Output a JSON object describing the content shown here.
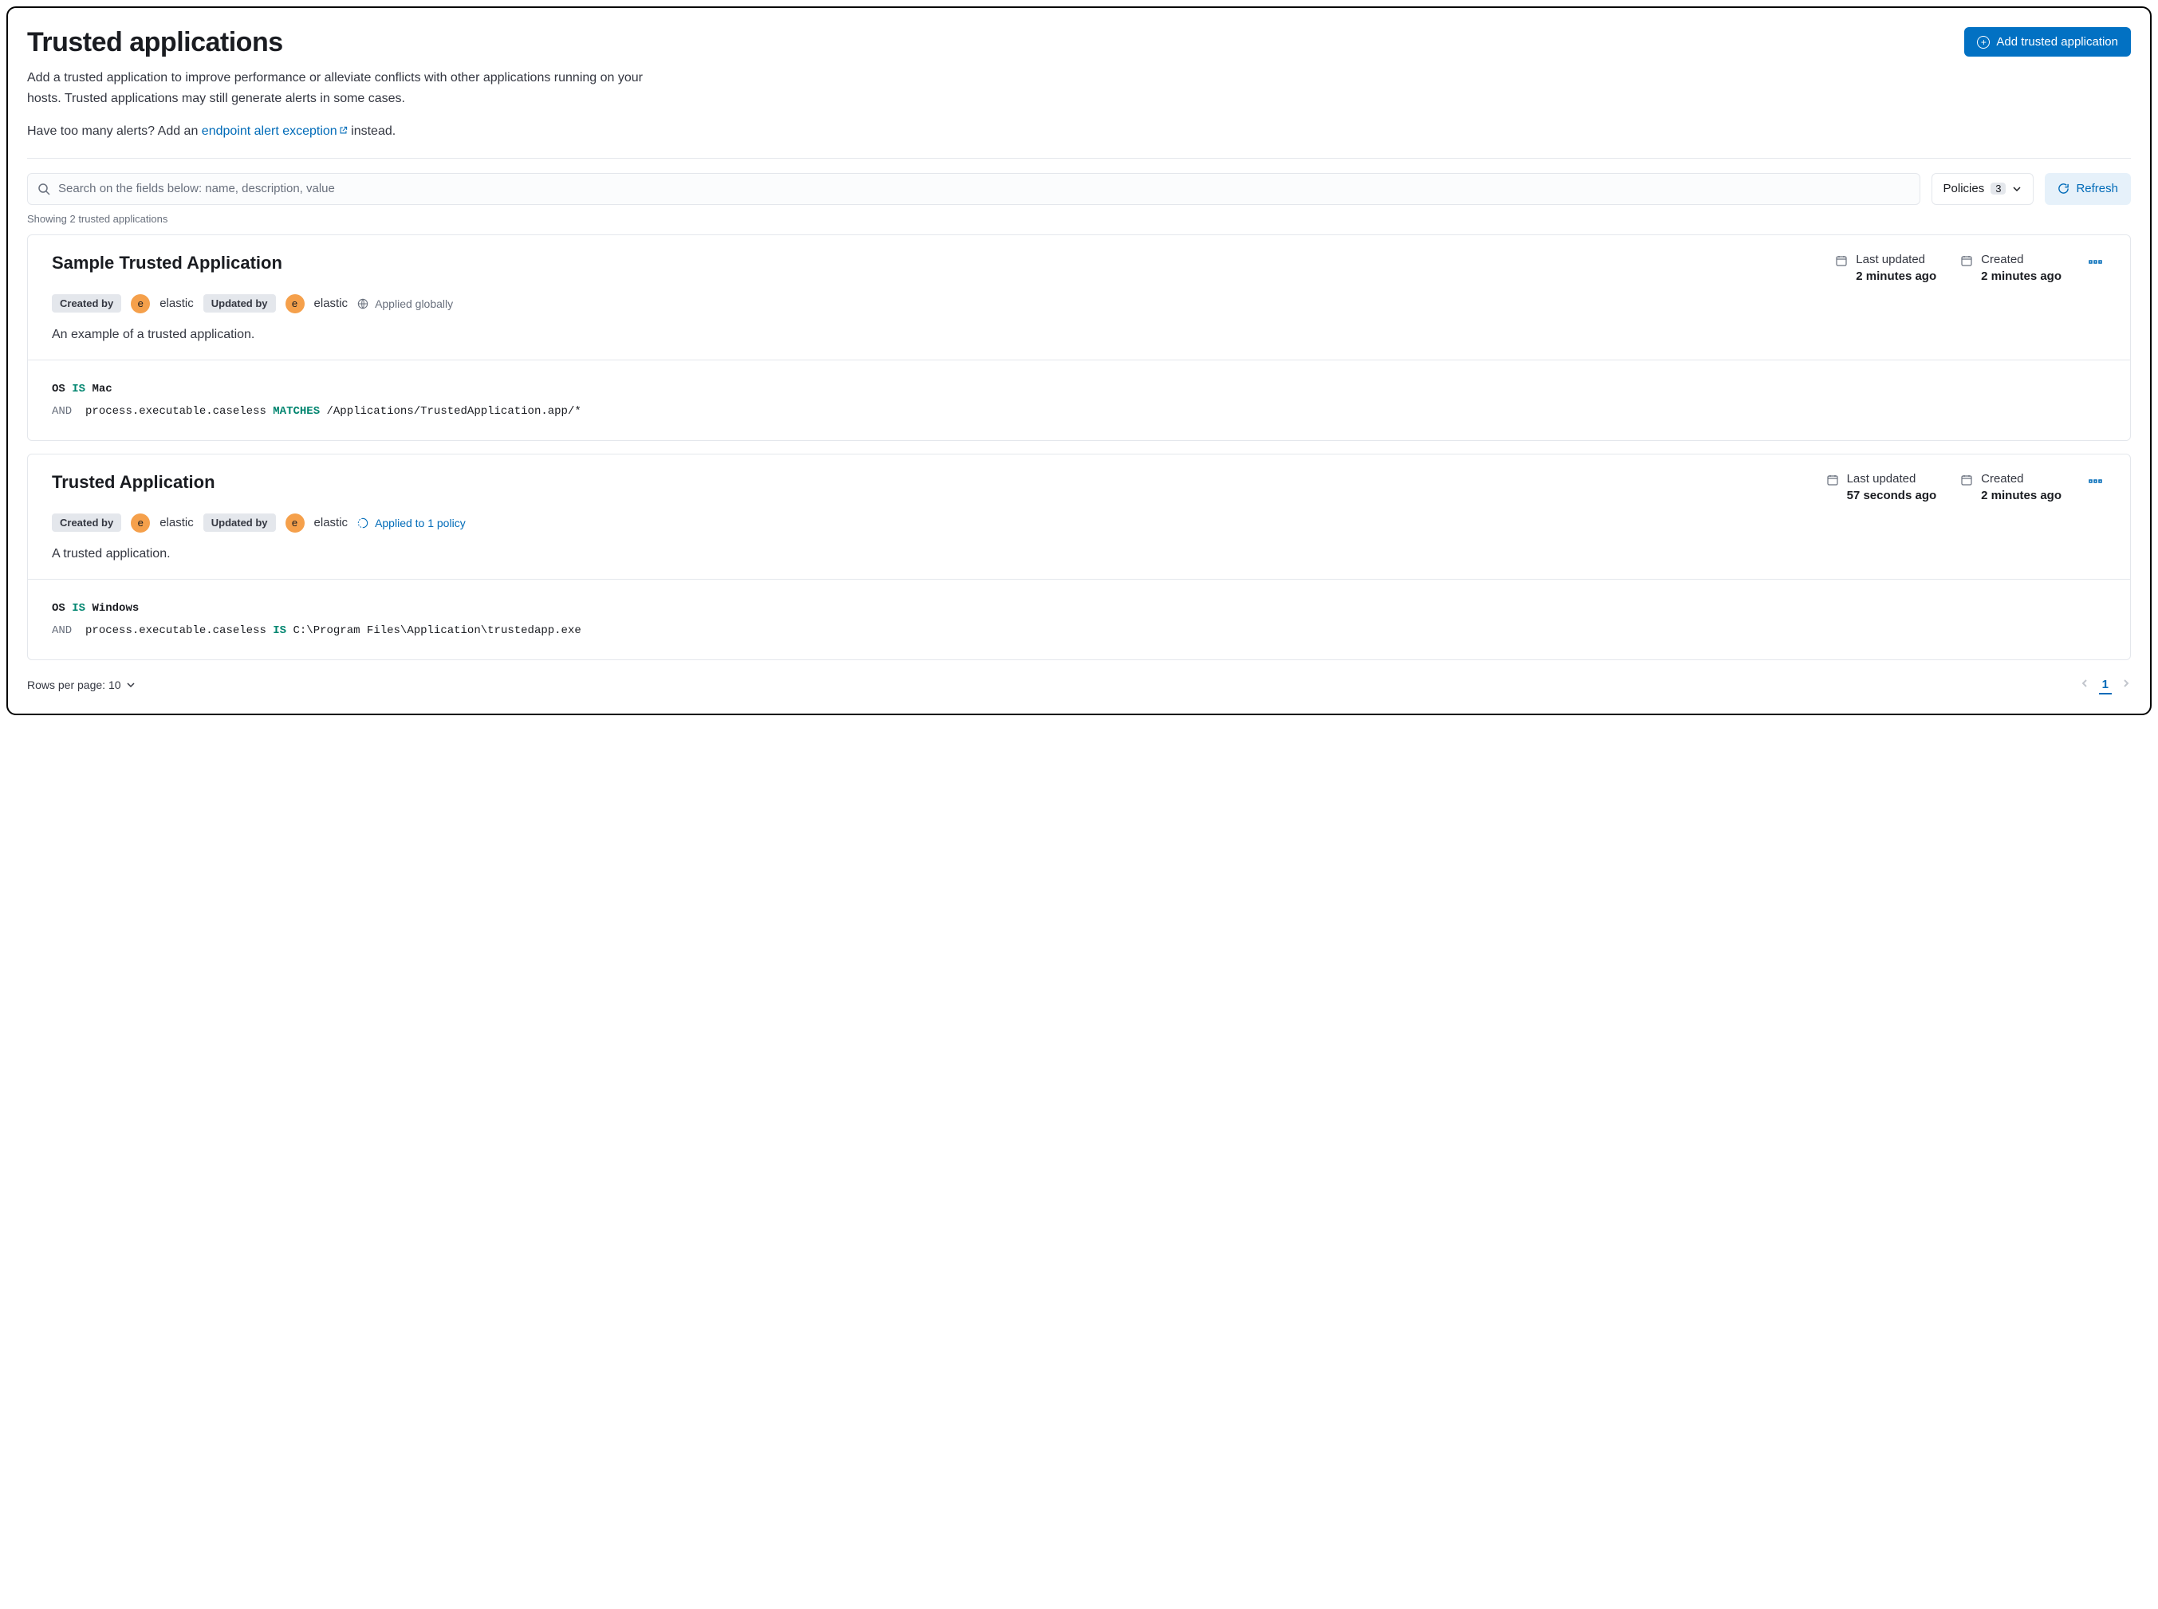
{
  "header": {
    "title": "Trusted applications",
    "add_button": "Add trusted application"
  },
  "description": {
    "text1": "Add a trusted application to improve performance or alleviate conflicts with other applications running on your hosts. Trusted applications may still generate alerts in some cases.",
    "text2_prefix": "Have too many alerts? Add an ",
    "link": "endpoint alert exception",
    "text2_suffix": " instead."
  },
  "controls": {
    "search_placeholder": "Search on the fields below: name, description, value",
    "policies_label": "Policies",
    "policies_count": "3",
    "refresh_label": "Refresh"
  },
  "showing_text": "Showing 2 trusted applications",
  "cards": [
    {
      "title": "Sample Trusted Application",
      "created_by_label": "Created by",
      "created_by_initial": "e",
      "created_by_user": "elastic",
      "updated_by_label": "Updated by",
      "updated_by_initial": "e",
      "updated_by_user": "elastic",
      "scope_type": "global",
      "scope_label": "Applied globally",
      "desc": "An example of a trusted application.",
      "last_updated_label": "Last updated",
      "last_updated_value": "2 minutes ago",
      "created_label": "Created",
      "created_value": "2 minutes ago",
      "cond1_kw": "OS",
      "cond1_op": "IS",
      "cond1_val": "Mac",
      "cond2_and": "AND",
      "cond2_field": "process.executable.caseless",
      "cond2_op": "MATCHES",
      "cond2_val": "/Applications/TrustedApplication.app/*"
    },
    {
      "title": "Trusted Application",
      "created_by_label": "Created by",
      "created_by_initial": "e",
      "created_by_user": "elastic",
      "updated_by_label": "Updated by",
      "updated_by_initial": "e",
      "updated_by_user": "elastic",
      "scope_type": "policy",
      "scope_label": "Applied to 1 policy",
      "desc": "A trusted application.",
      "last_updated_label": "Last updated",
      "last_updated_value": "57 seconds ago",
      "created_label": "Created",
      "created_value": "2 minutes ago",
      "cond1_kw": "OS",
      "cond1_op": "IS",
      "cond1_val": "Windows",
      "cond2_and": "AND",
      "cond2_field": "process.executable.caseless",
      "cond2_op": "IS",
      "cond2_val": "C:\\Program Files\\Application\\trustedapp.exe"
    }
  ],
  "footer": {
    "rows_label": "Rows per page: 10",
    "current_page": "1"
  }
}
